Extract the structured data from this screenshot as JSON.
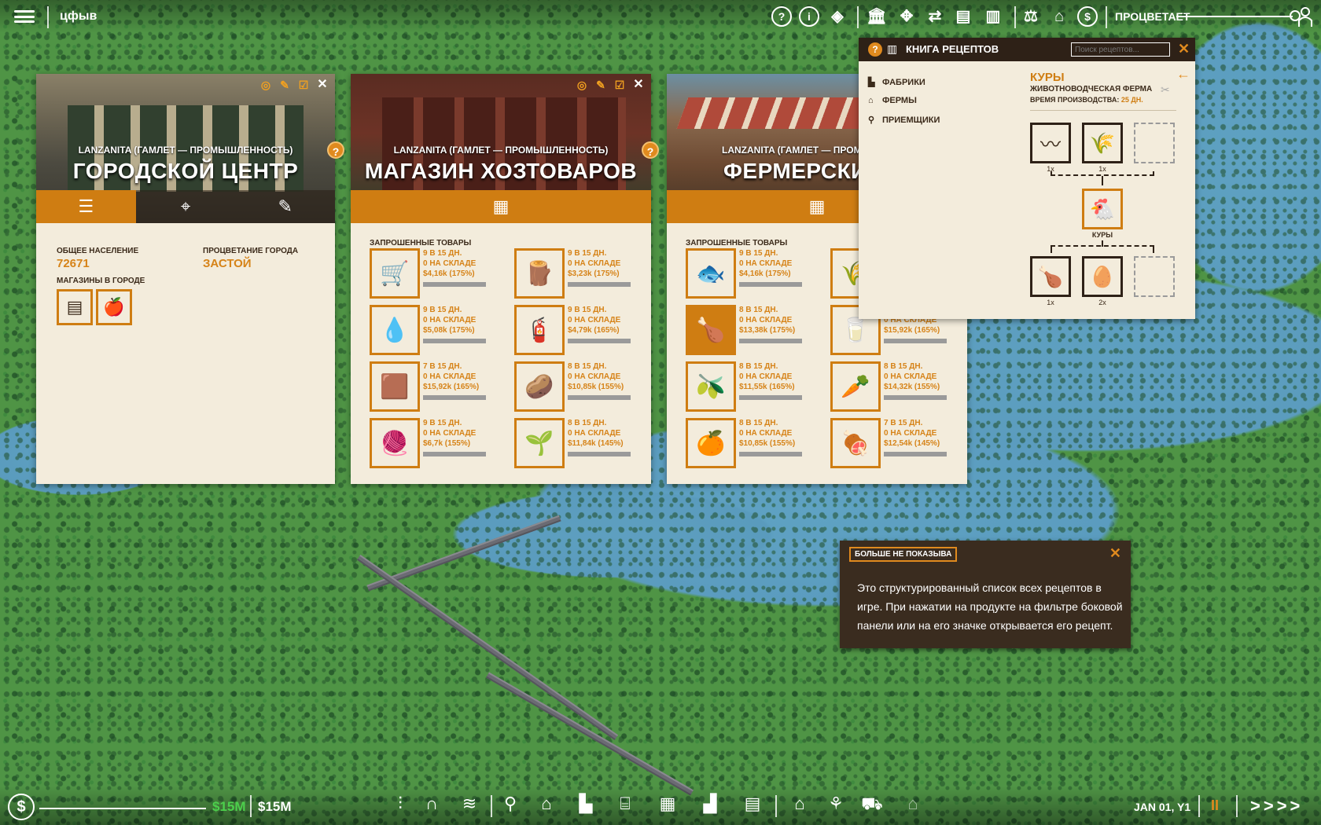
{
  "topbar": {
    "city_name": "цфыв",
    "prosperity_label": "ПРОЦВЕТАЕТ",
    "icons": [
      "help-icon",
      "info-icon",
      "layers-icon",
      "bank-icon",
      "move-icon",
      "transfer-icon",
      "train-icon",
      "book-icon",
      "balance-icon",
      "factory-icon",
      "dollar-icon"
    ]
  },
  "panel1": {
    "subtitle": "LANZANITA (ГАМЛЕТ — ПРОМЫШЛЕННОСТЬ)",
    "title": "ГОРОДСКОЙ ЦЕНТР",
    "population_label": "ОБЩЕЕ НАСЕЛЕНИЕ",
    "population_value": "72671",
    "prosperity_label": "ПРОЦВЕТАНИЕ ГОРОДА",
    "prosperity_value": "ЗАСТОЙ",
    "shops_label": "МАГАЗИНЫ В ГОРОДЕ",
    "shops": [
      "hardware-shop-icon",
      "grocery-shop-icon"
    ]
  },
  "panel2": {
    "subtitle": "LANZANITA (ГАМЛЕТ — ПРОМЫШЛЕННОСТЬ)",
    "title": "МАГАЗИН ХОЗТОВАРОВ",
    "section": "ЗАПРОШЕННЫЕ ТОВАРЫ",
    "goods": [
      {
        "icon": "coal-cart-icon",
        "glyph": "🛒",
        "l1": "9 В 15 ДН.",
        "l2": "0 НА СКЛАДЕ",
        "l3": "$4,16k (175%)"
      },
      {
        "icon": "wood-log-icon",
        "glyph": "🪵",
        "l1": "9 В 15 ДН.",
        "l2": "0 НА СКЛАДЕ",
        "l3": "$3,23k (175%)"
      },
      {
        "icon": "oil-drop-icon",
        "glyph": "💧",
        "l1": "9 В 15 ДН.",
        "l2": "0 НА СКЛАДЕ",
        "l3": "$5,08k (175%)"
      },
      {
        "icon": "gas-canister-icon",
        "glyph": "🧯",
        "l1": "9 В 15 ДН.",
        "l2": "0 НА СКЛАДЕ",
        "l3": "$4,79k (165%)"
      },
      {
        "icon": "leather-icon",
        "glyph": "🟫",
        "l1": "7 В 15 ДН.",
        "l2": "0 НА СКЛАДЕ",
        "l3": "$15,92k (165%)"
      },
      {
        "icon": "potato-icon",
        "glyph": "🥔",
        "l1": "8 В 15 ДН.",
        "l2": "0 НА СКЛАДЕ",
        "l3": "$10,85k (155%)"
      },
      {
        "icon": "yarn-ball-icon",
        "glyph": "🧶",
        "l1": "9 В 15 ДН.",
        "l2": "0 НА СКЛАДЕ",
        "l3": "$6,7k (155%)"
      },
      {
        "icon": "cotton-icon",
        "glyph": "🌱",
        "l1": "8 В 15 ДН.",
        "l2": "0 НА СКЛАДЕ",
        "l3": "$11,84k (145%)"
      }
    ]
  },
  "panel3": {
    "subtitle": "LANZANITA (ГАМЛЕТ — ПРОМЫШ",
    "title": "ФЕРМЕРСКИЙ Р",
    "section": "ЗАПРОШЕННЫЕ ТОВАРЫ",
    "goods": [
      {
        "icon": "fish-icon",
        "glyph": "🐟",
        "l1": "9 В 15 ДН.",
        "l2": "0 НА СКЛАДЕ",
        "l3": "$4,16k (175%)",
        "filled": false
      },
      {
        "icon": "wheat-icon",
        "glyph": "🌾",
        "l1": "",
        "l2": "",
        "l3": "",
        "filled": false
      },
      {
        "icon": "chicken-meat-icon",
        "glyph": "🍗",
        "l1": "8 В 15 ДН.",
        "l2": "0 НА СКЛАДЕ",
        "l3": "$13,38k (175%)",
        "filled": true
      },
      {
        "icon": "milk-icon",
        "glyph": "🥛",
        "l1": "",
        "l2": "0 НА СКЛАДЕ",
        "l3": "$15,92k (165%)",
        "filled": false
      },
      {
        "icon": "olive-icon",
        "glyph": "🫒",
        "l1": "8 В 15 ДН.",
        "l2": "0 НА СКЛАДЕ",
        "l3": "$11,55k (165%)",
        "filled": false
      },
      {
        "icon": "vegetables-icon",
        "glyph": "🥕",
        "l1": "8 В 15 ДН.",
        "l2": "0 НА СКЛАДЕ",
        "l3": "$14,32k (155%)",
        "filled": false
      },
      {
        "icon": "orange-icon",
        "glyph": "🍊",
        "l1": "8 В 15 ДН.",
        "l2": "0 НА СКЛАДЕ",
        "l3": "$10,85k (155%)",
        "filled": false
      },
      {
        "icon": "meat-icon",
        "glyph": "🍖",
        "l1": "7 В 15 ДН.",
        "l2": "0 НА СКЛАДЕ",
        "l3": "$12,54k (145%)",
        "filled": false
      }
    ]
  },
  "recipe": {
    "title": "КНИГА РЕЦЕПТОВ",
    "search_placeholder": "Поиск рецептов...",
    "sidebar": [
      "ФАБРИКИ",
      "ФЕРМЫ",
      "ПРИЕМЩИКИ"
    ],
    "product": "КУРЫ",
    "building": "ЖИВОТНОВОДЧЕСКАЯ ФЕРМА",
    "time_label": "ВРЕМЯ ПРОИЗВОДСТВА:",
    "time_value": "25 ДН.",
    "input1_qty": "1x",
    "input2_qty": "1x",
    "main_label": "КУРЫ",
    "output1_qty": "1x",
    "output2_qty": "2x"
  },
  "tooltip": {
    "button": "БОЛЬШЕ НЕ ПОКАЗЫВА",
    "text": "Это структурированный список всех рецептов в игре. При нажатии на продукте на фильтре боковой панели или на его значке открывается его рецепт."
  },
  "bottombar": {
    "money_income": "$15M",
    "money_total": "$15M",
    "date": "JAN 01, Y1",
    "pause": "II",
    "speed": ">>>>"
  }
}
